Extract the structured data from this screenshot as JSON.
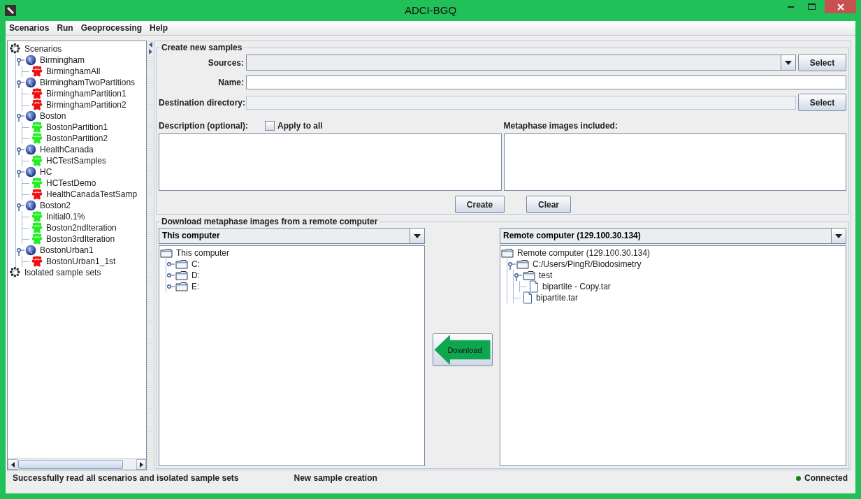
{
  "window": {
    "title": "ADCI-BGQ"
  },
  "menu": [
    "Scenarios",
    "Run",
    "Geoprocessing",
    "Help"
  ],
  "scenario_tree": [
    {
      "label": "Scenarios",
      "kind": "root",
      "children": [
        {
          "label": "Birmingham",
          "kind": "scenario",
          "expanded": true,
          "children": [
            {
              "label": "BirminghamAll",
              "kind": "sample",
              "color": "#ee1111"
            }
          ]
        },
        {
          "label": "BirminghamTwoPartitions",
          "kind": "scenario",
          "expanded": true,
          "children": [
            {
              "label": "BirminghamPartition1",
              "kind": "sample",
              "color": "#ee1111"
            },
            {
              "label": "BirminghamPartition2",
              "kind": "sample",
              "color": "#ee1111"
            }
          ]
        },
        {
          "label": "Boston",
          "kind": "scenario",
          "expanded": true,
          "children": [
            {
              "label": "BostonPartition1",
              "kind": "sample",
              "color": "#22ee22"
            },
            {
              "label": "BostonPartition2",
              "kind": "sample",
              "color": "#22ee22"
            }
          ]
        },
        {
          "label": "HealthCanada",
          "kind": "scenario",
          "expanded": true,
          "children": [
            {
              "label": "HCTestSamples",
              "kind": "sample",
              "color": "#22ee22"
            }
          ]
        },
        {
          "label": "HC",
          "kind": "scenario",
          "expanded": true,
          "children": [
            {
              "label": "HCTestDemo",
              "kind": "sample",
              "color": "#22ee22"
            },
            {
              "label": "HealthCanadaTestSamp",
              "kind": "sample",
              "color": "#ee1111"
            }
          ]
        },
        {
          "label": "Boston2",
          "kind": "scenario",
          "expanded": true,
          "children": [
            {
              "label": "Initial0.1%",
              "kind": "sample",
              "color": "#22ee22"
            },
            {
              "label": "Boston2ndIteration",
              "kind": "sample",
              "color": "#22ee22"
            },
            {
              "label": "Boston3rdIteration",
              "kind": "sample",
              "color": "#22ee22"
            }
          ]
        },
        {
          "label": "BostonUrban1",
          "kind": "scenario",
          "expanded": true,
          "children": [
            {
              "label": "BostonUrban1_1st",
              "kind": "sample",
              "color": "#ee1111"
            }
          ]
        }
      ]
    },
    {
      "label": "Isolated sample sets",
      "kind": "root"
    }
  ],
  "create_samples": {
    "title": "Create new samples",
    "fields": [
      {
        "label": "Sources:",
        "kind": "combo",
        "button": "Select"
      },
      {
        "label": "Name:",
        "kind": "text"
      },
      {
        "label": "Destination directory:",
        "kind": "readonly",
        "button": "Select"
      }
    ],
    "description_label": "Description (optional):",
    "apply_to_all": {
      "label": "Apply to all",
      "checked": false
    },
    "metaphase_label": "Metaphase images included:",
    "buttons": [
      "Create",
      "Clear"
    ]
  },
  "download": {
    "title": "Download metaphase images from a remote computer",
    "local": {
      "combo": "This computer",
      "tree": [
        {
          "label": "This computer",
          "kind": "computer",
          "children": [
            {
              "label": "C:",
              "kind": "folder",
              "expanded": false
            },
            {
              "label": "D:",
              "kind": "folder",
              "expanded": false
            },
            {
              "label": "E:",
              "kind": "folder",
              "expanded": false
            }
          ]
        }
      ]
    },
    "button": "Download",
    "remote": {
      "combo": "Remote computer (129.100.30.134)",
      "tree": [
        {
          "label": "Remote computer (129.100.30.134)",
          "kind": "computer",
          "children": [
            {
              "label": "C:/Users/PingR/Biodosimetry",
              "kind": "folder",
              "expanded": true,
              "children": [
                {
                  "label": "test",
                  "kind": "folder",
                  "expanded": true,
                  "children": [
                    {
                      "label": "bipartite - Copy.tar",
                      "kind": "file"
                    }
                  ]
                },
                {
                  "label": "bipartite.tar",
                  "kind": "file"
                }
              ]
            }
          ]
        }
      ]
    }
  },
  "status_bar": {
    "message": "Successfully read all scenarios and isolated sample sets",
    "mode": "New sample creation",
    "connection": {
      "label": "Connected",
      "connected": true
    }
  }
}
